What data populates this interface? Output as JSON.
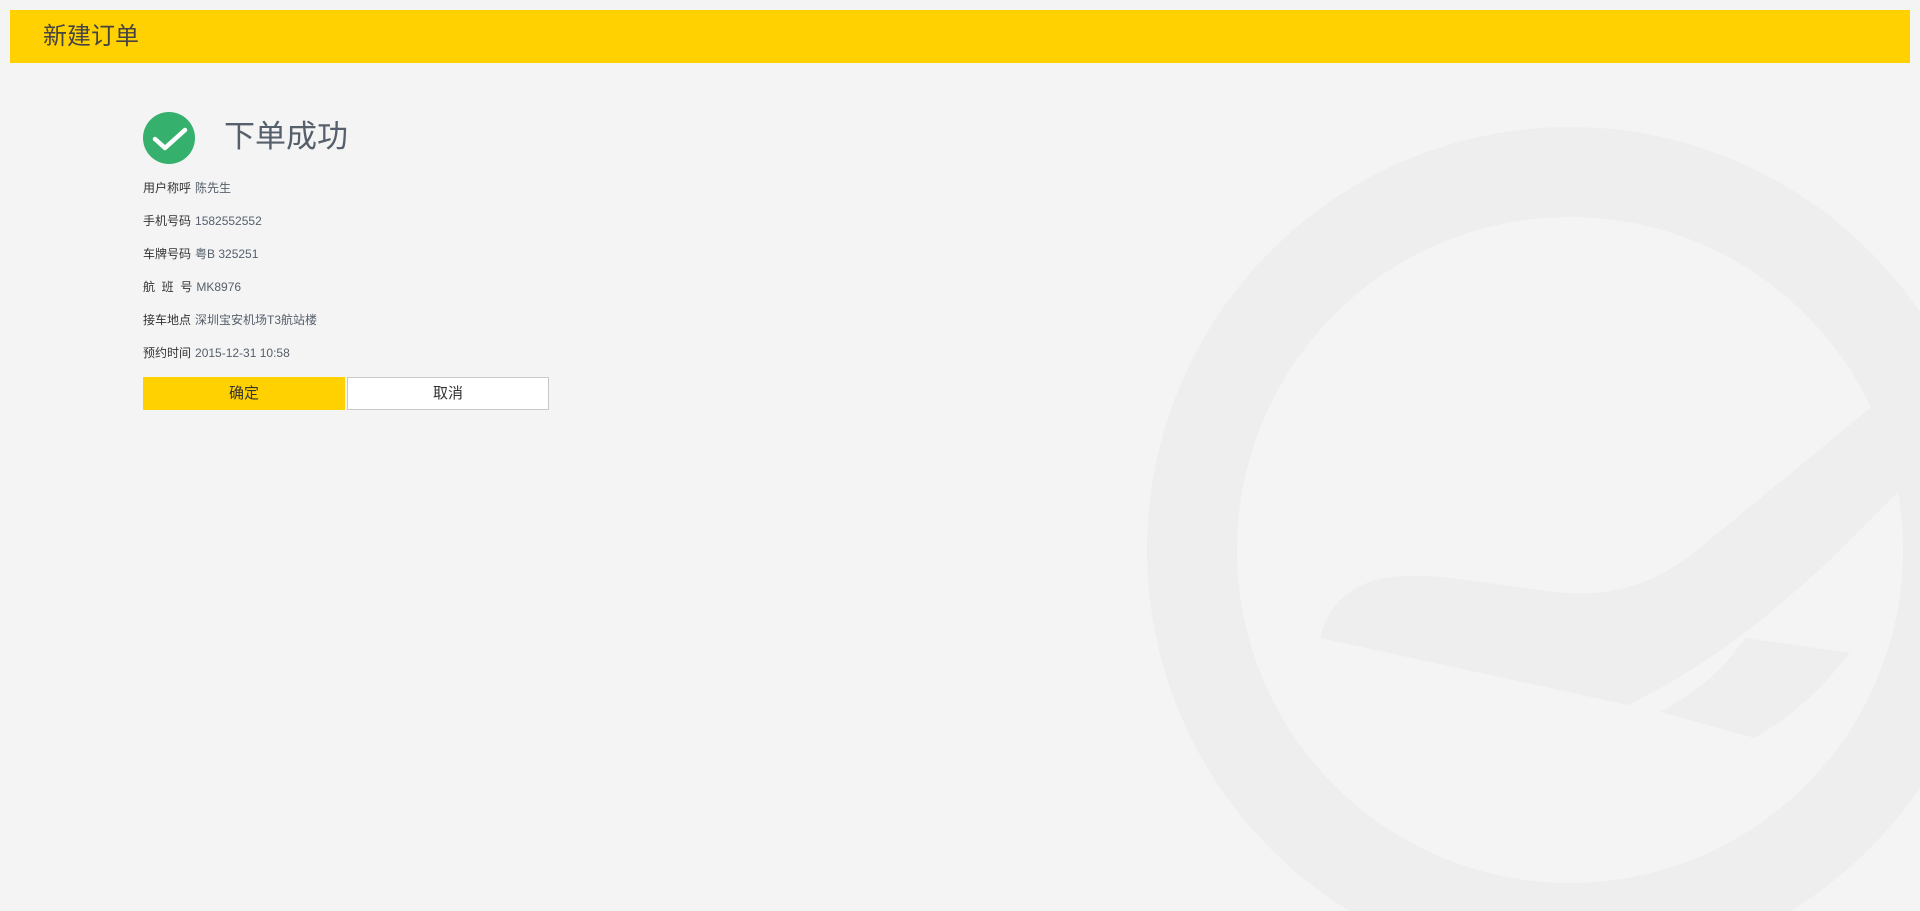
{
  "header": {
    "title": "新建订单"
  },
  "result": {
    "title": "下单成功",
    "icon": "check-circle-icon"
  },
  "order": {
    "rows": [
      {
        "label": "用户称呼",
        "value": "陈先生"
      },
      {
        "label": "手机号码",
        "value": "1582552552"
      },
      {
        "label": "车牌号码",
        "value": "粤B 325251"
      },
      {
        "label": "航  班  号",
        "value": "MK8976"
      },
      {
        "label": "接车地点",
        "value": "深圳宝安机场T3航站楼"
      },
      {
        "label": "预约时间",
        "value": "2015-12-31 10:58"
      }
    ]
  },
  "actions": {
    "confirm_label": "确定",
    "cancel_label": "取消"
  },
  "colors": {
    "accent": "#ffd100",
    "success": "#35b06d",
    "background": "#f4f4f4",
    "watermark": "#eeeeee"
  },
  "watermark_icon": "logo-watermark-icon"
}
